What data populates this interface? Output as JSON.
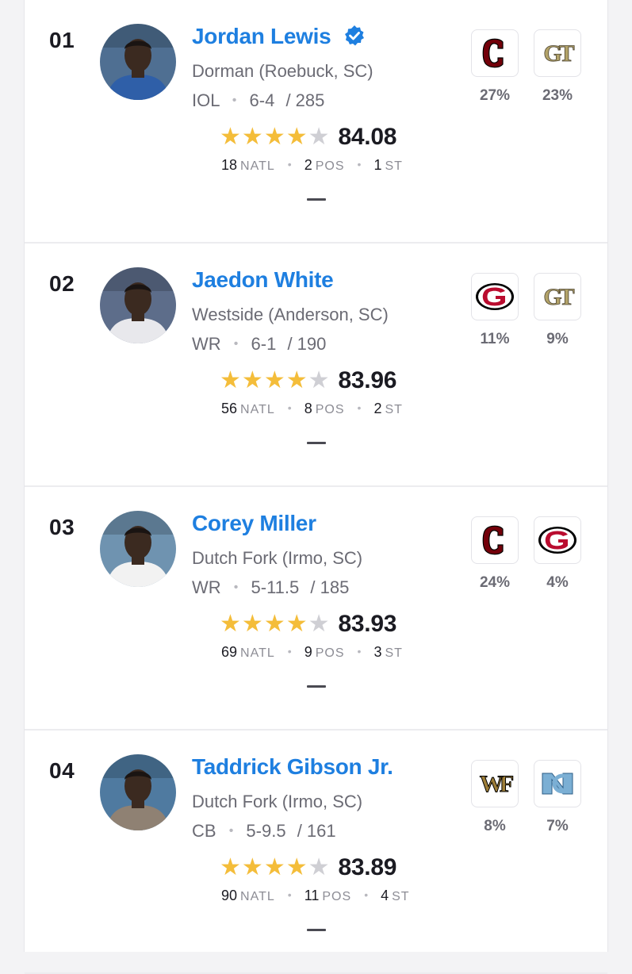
{
  "players": [
    {
      "rank": "01",
      "name": "Jordan Lewis",
      "verified": true,
      "school": "Dorman (Roebuck, SC)",
      "position": "IOL",
      "height": "6-4",
      "weight": "/ 285",
      "stars": 4,
      "rating": "84.08",
      "natl": "18",
      "pos": "2",
      "st": "1",
      "avatar_bg": "#4f6f92",
      "shirt": "#2f5fa8",
      "schools": [
        {
          "icon": "south-carolina-logo",
          "pct": "27%"
        },
        {
          "icon": "georgia-tech-logo",
          "pct": "23%"
        }
      ]
    },
    {
      "rank": "02",
      "name": "Jaedon White",
      "verified": false,
      "school": "Westside (Anderson, SC)",
      "position": "WR",
      "height": "6-1",
      "weight": "/ 190",
      "stars": 4,
      "rating": "83.96",
      "natl": "56",
      "pos": "8",
      "st": "2",
      "avatar_bg": "#5d6d8a",
      "shirt": "#e8e8ec",
      "schools": [
        {
          "icon": "georgia-logo",
          "pct": "11%"
        },
        {
          "icon": "georgia-tech-logo",
          "pct": "9%"
        }
      ]
    },
    {
      "rank": "03",
      "name": "Corey Miller",
      "verified": false,
      "school": "Dutch Fork (Irmo, SC)",
      "position": "WR",
      "height": "5-11.5",
      "weight": "/ 185",
      "stars": 4,
      "rating": "83.93",
      "natl": "69",
      "pos": "9",
      "st": "3",
      "avatar_bg": "#6f93b0",
      "shirt": "#f2f2f2",
      "schools": [
        {
          "icon": "south-carolina-logo",
          "pct": "24%"
        },
        {
          "icon": "georgia-logo",
          "pct": "4%"
        }
      ]
    },
    {
      "rank": "04",
      "name": "Taddrick Gibson Jr.",
      "verified": false,
      "school": "Dutch Fork (Irmo, SC)",
      "position": "CB",
      "height": "5-9.5",
      "weight": "/ 161",
      "stars": 4,
      "rating": "83.89",
      "natl": "90",
      "pos": "11",
      "st": "4",
      "avatar_bg": "#4f7aa0",
      "shirt": "#8f8173",
      "schools": [
        {
          "icon": "wake-forest-logo",
          "pct": "8%"
        },
        {
          "icon": "north-carolina-logo",
          "pct": "7%"
        }
      ]
    }
  ],
  "labels": {
    "natl": "NATL",
    "pos": "POS",
    "st": "ST"
  },
  "colors": {
    "link": "#1e7fe0",
    "star_on": "#f4bd3a",
    "star_off": "#cfcfd4",
    "sc_garnet": "#73000a",
    "uga_red": "#ba0c2f",
    "gt_gold": "#b3a369",
    "wf_gold": "#9e7e38",
    "unc_blue": "#7bafd4"
  }
}
